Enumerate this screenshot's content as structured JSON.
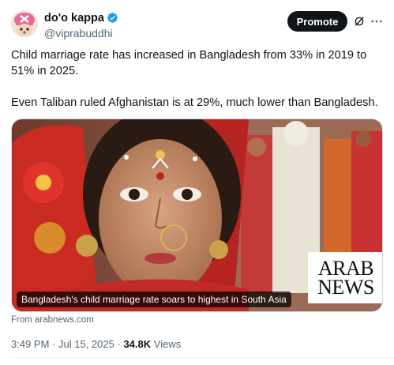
{
  "author": {
    "name": "do'o kappa",
    "handle": "@viprabuddhi",
    "verified": true,
    "avatar_icon": "chopper-avatar"
  },
  "actions": {
    "promote_label": "Promote",
    "grok_icon": "grok-icon",
    "more_icon": "more-icon"
  },
  "tweet": {
    "paragraph_1": "Child marriage rate has increased in Bangladesh from 33% in 2019 to 51% in 2025.",
    "paragraph_2": "Even Taliban ruled Afghanistan is at 29%, much lower than Bangladesh."
  },
  "card": {
    "caption": "Bangladesh's child marriage rate soars to highest in South Asia",
    "logo_line_1": "ARAB",
    "logo_line_2": "NEWS",
    "source": "From arabnews.com"
  },
  "meta": {
    "time": "3:49 PM",
    "separator": "·",
    "date": "Jul 15, 2025",
    "views_count": "34.8K",
    "views_label": "Views"
  },
  "colors": {
    "accent": "#1d9bf0",
    "text_primary": "#0f1419",
    "text_secondary": "#536471",
    "button_dark": "#0f1419"
  }
}
